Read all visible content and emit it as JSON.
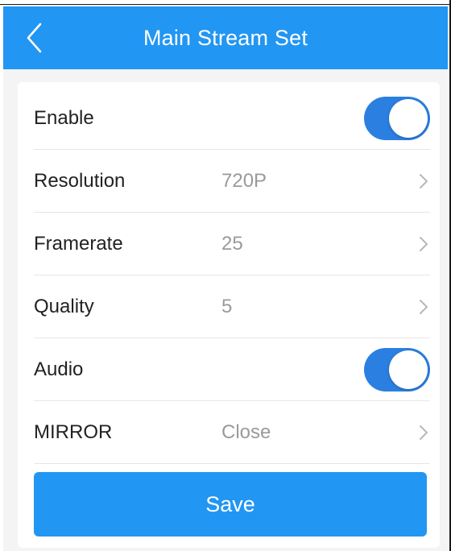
{
  "header": {
    "title": "Main Stream Set",
    "background": "#2196f3",
    "back_icon": "chevron-left-icon"
  },
  "settings": {
    "enable": {
      "label": "Enable",
      "on": true
    },
    "resolution": {
      "label": "Resolution",
      "value": "720P"
    },
    "framerate": {
      "label": "Framerate",
      "value": "25"
    },
    "quality": {
      "label": "Quality",
      "value": "5"
    },
    "audio": {
      "label": "Audio",
      "on": true
    },
    "mirror": {
      "label": "MIRROR",
      "value": "Close"
    }
  },
  "actions": {
    "save_label": "Save"
  },
  "colors": {
    "accent": "#2196f3",
    "toggle_on": "#2b7fe0",
    "value_text": "#9a9a9a"
  }
}
